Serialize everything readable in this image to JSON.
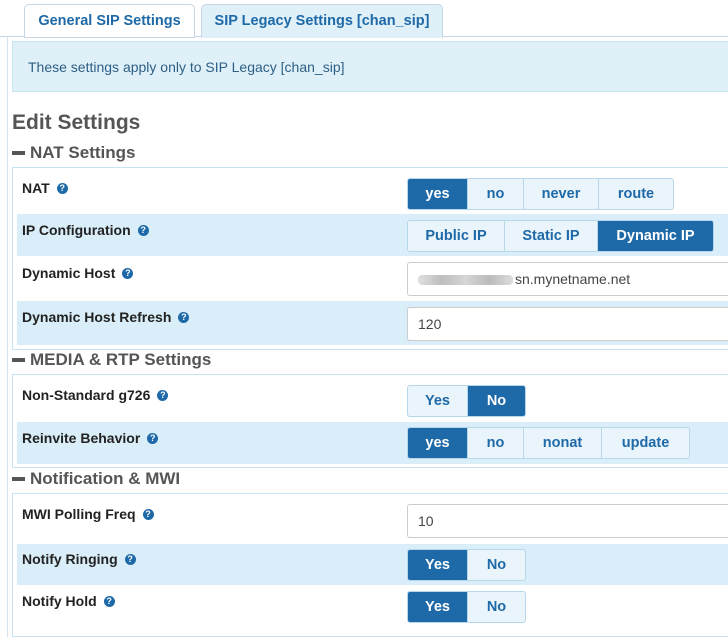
{
  "tabs": [
    {
      "label": "General SIP Settings"
    },
    {
      "label": "SIP Legacy Settings [chan_sip]"
    }
  ],
  "info_text": "These settings apply only to SIP Legacy [chan_sip]",
  "page_heading": "Edit Settings",
  "sections": {
    "nat": {
      "title": "NAT Settings",
      "nat": {
        "label": "NAT",
        "options": [
          "yes",
          "no",
          "never",
          "route"
        ],
        "selected": "yes"
      },
      "ip_config": {
        "label": "IP Configuration",
        "options": [
          "Public IP",
          "Static IP",
          "Dynamic IP"
        ],
        "selected": "Dynamic IP"
      },
      "dynamic_host": {
        "label": "Dynamic Host",
        "value": "sn.mynetname.net"
      },
      "dynamic_host_refresh": {
        "label": "Dynamic Host Refresh",
        "value": "120"
      }
    },
    "media": {
      "title": "MEDIA & RTP Settings",
      "g726": {
        "label": "Non-Standard g726",
        "options": [
          "Yes",
          "No"
        ],
        "selected": "No"
      },
      "reinvite": {
        "label": "Reinvite Behavior",
        "options": [
          "yes",
          "no",
          "nonat",
          "update"
        ],
        "selected": "yes"
      }
    },
    "notify": {
      "title": "Notification & MWI",
      "mwi": {
        "label": "MWI Polling Freq",
        "value": "10"
      },
      "ringing": {
        "label": "Notify Ringing",
        "options": [
          "Yes",
          "No"
        ],
        "selected": "Yes"
      },
      "hold": {
        "label": "Notify Hold",
        "options": [
          "Yes",
          "No"
        ],
        "selected": "Yes"
      }
    }
  },
  "help_glyph": "?",
  "icons": {
    "help": "question-circle-icon",
    "collapse": "minus-icon"
  },
  "colors": {
    "accent": "#1e69a8",
    "row_shade": "#d9eef8",
    "info_bg": "#dff0f9"
  }
}
